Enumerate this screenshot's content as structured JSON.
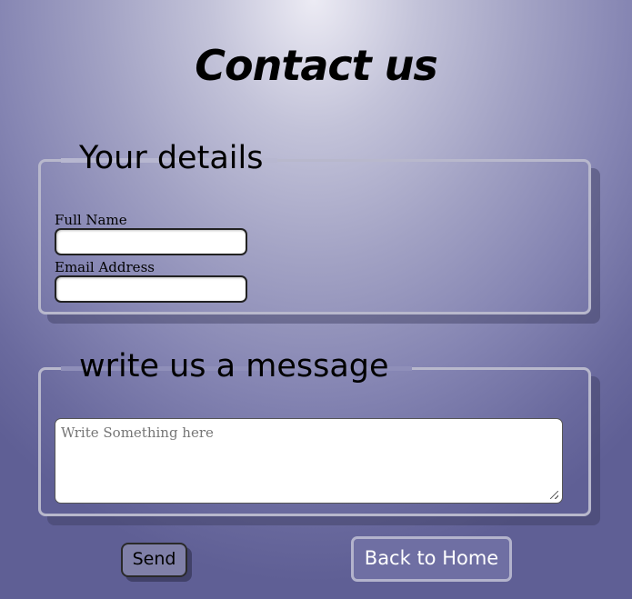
{
  "page": {
    "title": "Contact us"
  },
  "details": {
    "legend": "Your details",
    "full_name_label": "Full Name",
    "full_name_value": "",
    "email_label": "Email Address",
    "email_value": ""
  },
  "message": {
    "legend": "write us a message",
    "placeholder": "Write Something here",
    "value": ""
  },
  "actions": {
    "send_label": "Send",
    "home_label": "Back to Home"
  },
  "colors": {
    "background_top": "#ecebf4",
    "background_bottom": "#5f5f95",
    "fieldset_border": "#b8b8cc",
    "home_button_bg": "#6f6fa3"
  }
}
